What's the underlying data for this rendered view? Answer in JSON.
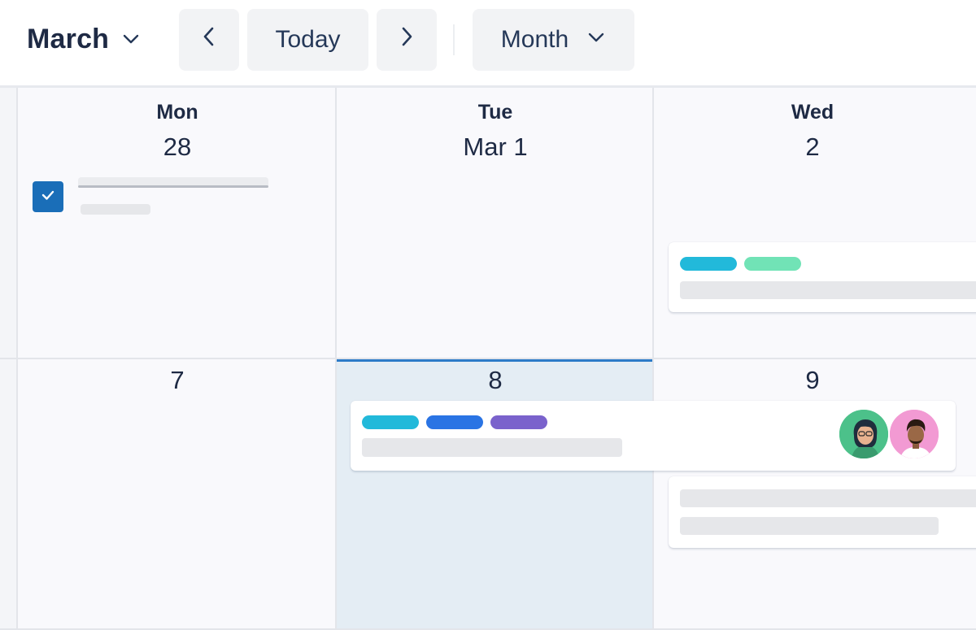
{
  "toolbar": {
    "month_label": "March",
    "today_label": "Today",
    "view_label": "Month"
  },
  "days": [
    {
      "dow": "Mon",
      "num": "28"
    },
    {
      "dow": "Tue",
      "num": "Mar 1"
    },
    {
      "dow": "Wed",
      "num": "2"
    },
    {
      "num": "7"
    },
    {
      "num": "8"
    },
    {
      "num": "9"
    }
  ],
  "colors": {
    "accent": "#1a6eb8",
    "today_bg": "#e4edf4",
    "today_border": "#2c7bc8",
    "label_cyan": "#22b9da",
    "label_mint": "#71e3b6",
    "label_blue": "#2a74e4",
    "label_purple": "#7a62cc",
    "avatar_green": "#4cc18a",
    "avatar_pink": "#f29ad3"
  },
  "events": {
    "task_mon28": {
      "checked": true
    },
    "wed2_labels": [
      "label_cyan",
      "label_mint"
    ],
    "tue8_labels": [
      "label_cyan",
      "label_blue",
      "label_purple"
    ],
    "tue8_avatars": [
      "avatar-woman",
      "avatar-man"
    ]
  }
}
